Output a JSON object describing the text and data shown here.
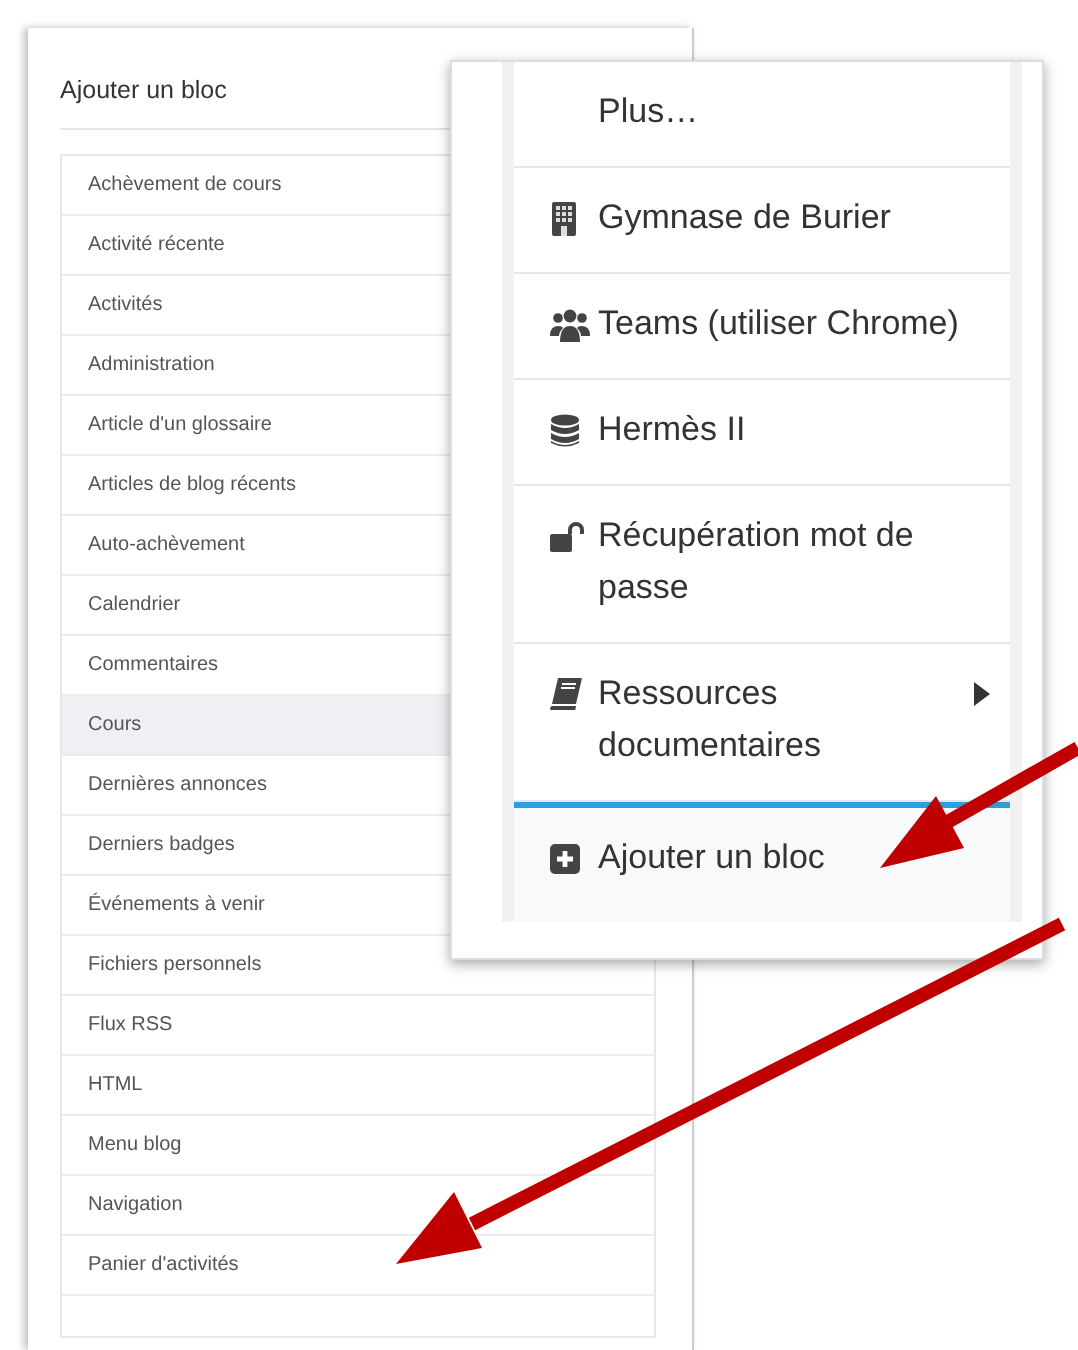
{
  "block_panel": {
    "title": "Ajouter un bloc",
    "items": [
      {
        "label": "Achèvement de cours",
        "highlighted": false
      },
      {
        "label": "Activité récente",
        "highlighted": false
      },
      {
        "label": "Activités",
        "highlighted": false
      },
      {
        "label": "Administration",
        "highlighted": false
      },
      {
        "label": "Article d'un glossaire",
        "highlighted": false
      },
      {
        "label": "Articles de blog récents",
        "highlighted": false
      },
      {
        "label": "Auto-achèvement",
        "highlighted": false
      },
      {
        "label": "Calendrier",
        "highlighted": false
      },
      {
        "label": "Commentaires",
        "highlighted": false
      },
      {
        "label": "Cours",
        "highlighted": true
      },
      {
        "label": "Dernières annonces",
        "highlighted": false
      },
      {
        "label": "Derniers badges",
        "highlighted": false
      },
      {
        "label": "Événements à venir",
        "highlighted": false
      },
      {
        "label": "Fichiers personnels",
        "highlighted": false
      },
      {
        "label": "Flux RSS",
        "highlighted": false
      },
      {
        "label": "HTML",
        "highlighted": false
      },
      {
        "label": "Menu blog",
        "highlighted": false
      },
      {
        "label": "Navigation",
        "highlighted": false
      },
      {
        "label": "Panier d'activités",
        "highlighted": false
      }
    ]
  },
  "nav_menu": {
    "items": [
      {
        "label": "Plus…",
        "kind": "text",
        "selected": false,
        "submenu": false
      },
      {
        "label": "Gymnase de Burier",
        "kind": "building",
        "selected": false,
        "submenu": false
      },
      {
        "label": "Teams (utiliser Chrome)",
        "kind": "users",
        "selected": false,
        "submenu": false
      },
      {
        "label": "Hermès II",
        "kind": "database",
        "selected": false,
        "submenu": false
      },
      {
        "label": "Récupération mot de passe",
        "kind": "unlock",
        "selected": false,
        "submenu": false
      },
      {
        "label": "Ressources documentaires",
        "kind": "book",
        "selected": false,
        "submenu": true
      },
      {
        "label": "Ajouter un bloc",
        "kind": "plus",
        "selected": true,
        "submenu": false
      }
    ]
  }
}
